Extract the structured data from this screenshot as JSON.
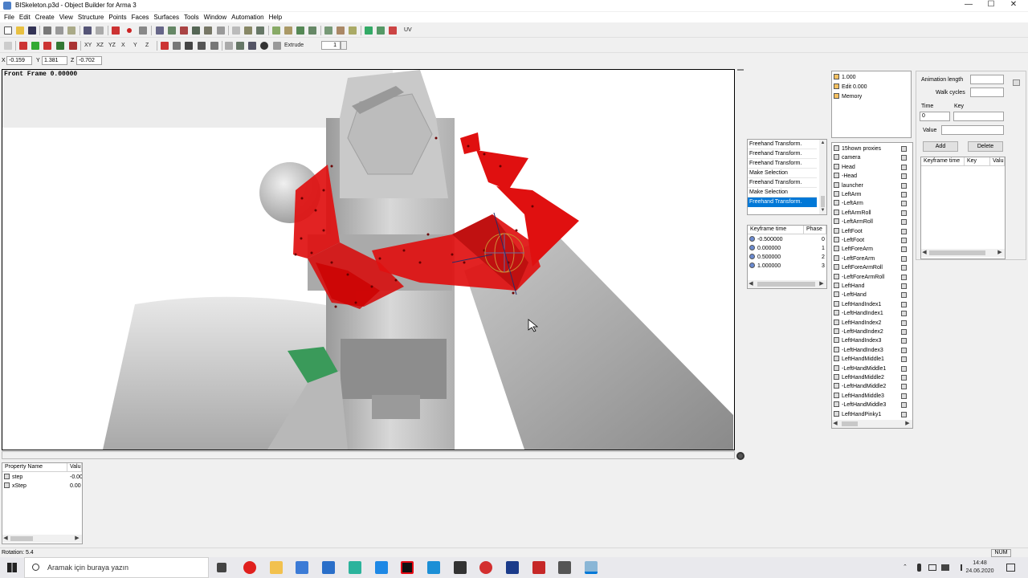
{
  "window": {
    "title": "BISkeleton.p3d - Object Builder for Arma 3",
    "minimize": "—",
    "maximize": "☐",
    "close": "✕"
  },
  "menu": [
    "File",
    "Edit",
    "Create",
    "View",
    "Structure",
    "Points",
    "Faces",
    "Surfaces",
    "Tools",
    "Window",
    "Automation",
    "Help"
  ],
  "toolbar2": {
    "axis_labels": [
      "XY",
      "XZ",
      "YZ",
      "X",
      "Y",
      "Z"
    ],
    "extrude_label": "Extrude",
    "extrude_value": "1"
  },
  "toolbar1": {
    "uv_label": "UV"
  },
  "coords": {
    "x_label": "X",
    "x_value": "-0.159",
    "y_label": "Y",
    "y_value": "1.381",
    "z_label": "Z",
    "z_value": "-0.702"
  },
  "viewport": {
    "frame_label": "Front Frame 0.00000"
  },
  "lod_list": {
    "items": [
      "1.000",
      "Edit 0.000",
      "Memory"
    ]
  },
  "history": {
    "items": [
      "Freehand Transform.",
      "Freehand Transform.",
      "Freehand Transform.",
      "Make Selection",
      "Freehand Transform.",
      "Make Selection",
      "Freehand Transform."
    ],
    "selected_index": 6
  },
  "keyframes": {
    "headers": [
      "Keyframe time",
      "Phase"
    ],
    "rows": [
      {
        "time": "-0.500000",
        "phase": "0"
      },
      {
        "time": "0.000000",
        "phase": "1"
      },
      {
        "time": "0.500000",
        "phase": "2"
      },
      {
        "time": "1.000000",
        "phase": "3"
      }
    ]
  },
  "selections": {
    "items": [
      "15hown proxies",
      "camera",
      "Head",
      "-Head",
      "launcher",
      "LeftArm",
      "-LeftArm",
      "LeftArmRoll",
      "-LeftArmRoll",
      "LeftFoot",
      "-LeftFoot",
      "LeftForeArm",
      "-LeftForeArm",
      "LeftForeArmRoll",
      "-LeftForeArmRoll",
      "LeftHand",
      "-LeftHand",
      "LeftHandIndex1",
      "-LeftHandIndex1",
      "LeftHandIndex2",
      "-LeftHandIndex2",
      "LeftHandIndex3",
      "-LeftHandIndex3",
      "LeftHandMiddle1",
      "-LeftHandMiddle1",
      "LeftHandMiddle2",
      "-LeftHandMiddle2",
      "LeftHandMiddle3",
      "-LeftHandMiddle3",
      "LeftHandPinky1"
    ]
  },
  "animation": {
    "length_label": "Animation length",
    "walk_cycles_label": "Walk cycles",
    "time_label": "Time",
    "key_label": "Key",
    "time_value": "0",
    "value_label": "Value",
    "add_button": "Add",
    "delete_button": "Delete",
    "table_headers": [
      "Keyframe time",
      "Key",
      "Valu"
    ]
  },
  "properties": {
    "headers": [
      "Property Name",
      "Valu"
    ],
    "rows": [
      {
        "name": "step",
        "value": "-0.00"
      },
      {
        "name": "xStep",
        "value": "0.00"
      }
    ]
  },
  "status": {
    "text": "Rotation: 5.4",
    "num": "NUM"
  },
  "taskbar": {
    "search_placeholder": "Aramak için buraya yazın",
    "time": "14:48",
    "date": "24.06.2020"
  },
  "colors": {
    "selection_red": "#e01010",
    "mesh_gray": "#bdbdbd",
    "highlight_blue": "#0078d7",
    "accent_green": "#3a9a5a"
  }
}
